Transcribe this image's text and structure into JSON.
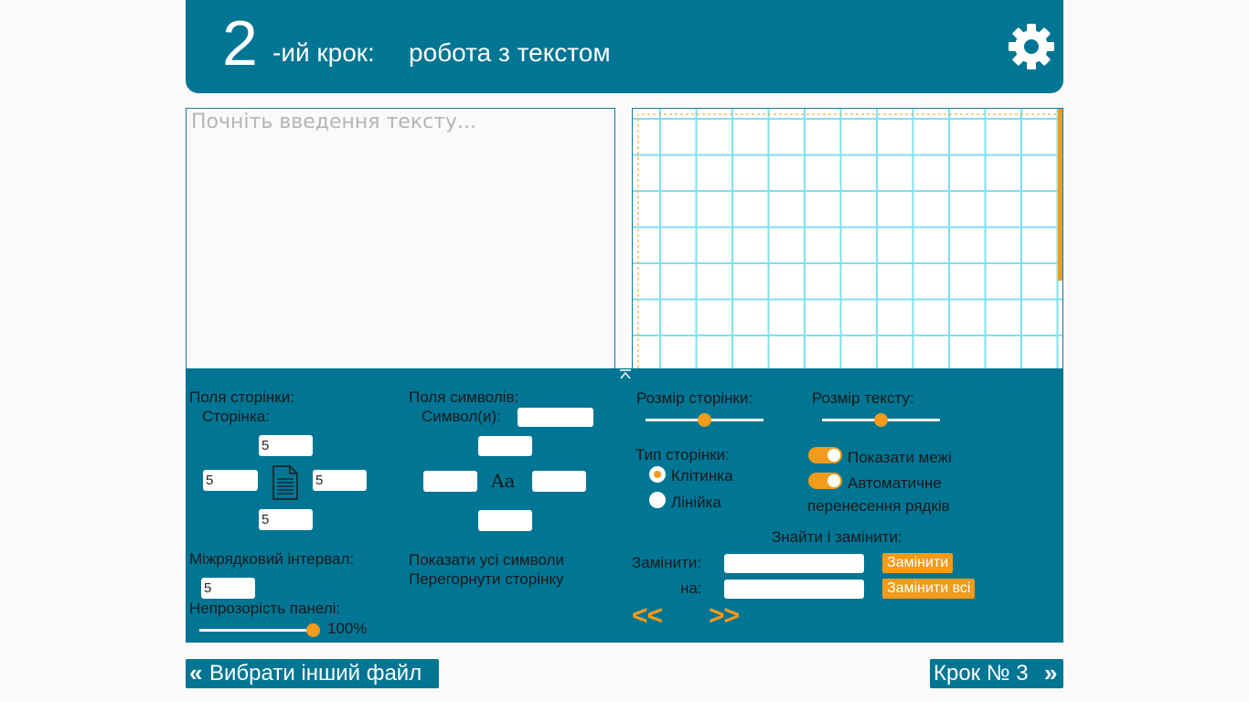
{
  "header": {
    "step_number": "2",
    "step_suffix": "-ий крок:",
    "title": "робота з текстом"
  },
  "editor": {
    "placeholder": "Почніть введення тексту..."
  },
  "page_margins": {
    "heading": "Поля сторінки:",
    "subheading": "Сторінка:",
    "top": "5",
    "left": "5",
    "right": "5",
    "bottom": "5"
  },
  "symbol_margins": {
    "heading": "Поля символів:",
    "symbols_label": "Символ(и):",
    "symbols_value": "",
    "top": "",
    "left": "",
    "right": "",
    "bottom": "",
    "sample": "Aa"
  },
  "line_spacing": {
    "label": "Міжрядковий інтервал:",
    "value": "5"
  },
  "opacity": {
    "label": "Непрозорість панелі:",
    "value_text": "100%",
    "value": 1.0
  },
  "links": {
    "show_all_symbols": "Показати усі символи",
    "flip_page": "Перегорнути сторінку"
  },
  "page_size": {
    "label": "Розмір сторінки:",
    "value": 0.5
  },
  "text_size": {
    "label": "Розмір тексту:",
    "value": 0.5
  },
  "page_type": {
    "label": "Тип сторінки:",
    "options": [
      "Клітинка",
      "Лінійка"
    ],
    "selected": "Клітинка"
  },
  "toggles": {
    "show_bounds": "Показати межі",
    "auto_wrap_1": "Автоматичне",
    "auto_wrap_2": "перенесення рядків"
  },
  "find_replace": {
    "heading": "Знайти і замінити:",
    "find_label": "Замінити:",
    "replace_label": "на:",
    "find_value": "",
    "replace_value": "",
    "replace_button": "Замінити",
    "replace_all_button": "Замінити всі",
    "prev": "<<",
    "next": ">>"
  },
  "footer": {
    "back_icon": "«",
    "back_label": "Вибрати інший файл",
    "next_label": "Крок № 3",
    "next_icon": "»"
  },
  "colors": {
    "primary": "#007594",
    "accent": "#f39b1a",
    "grid": "#7fe0ee"
  },
  "icons": [
    "gear-icon",
    "document-icon",
    "collapse-icon"
  ]
}
